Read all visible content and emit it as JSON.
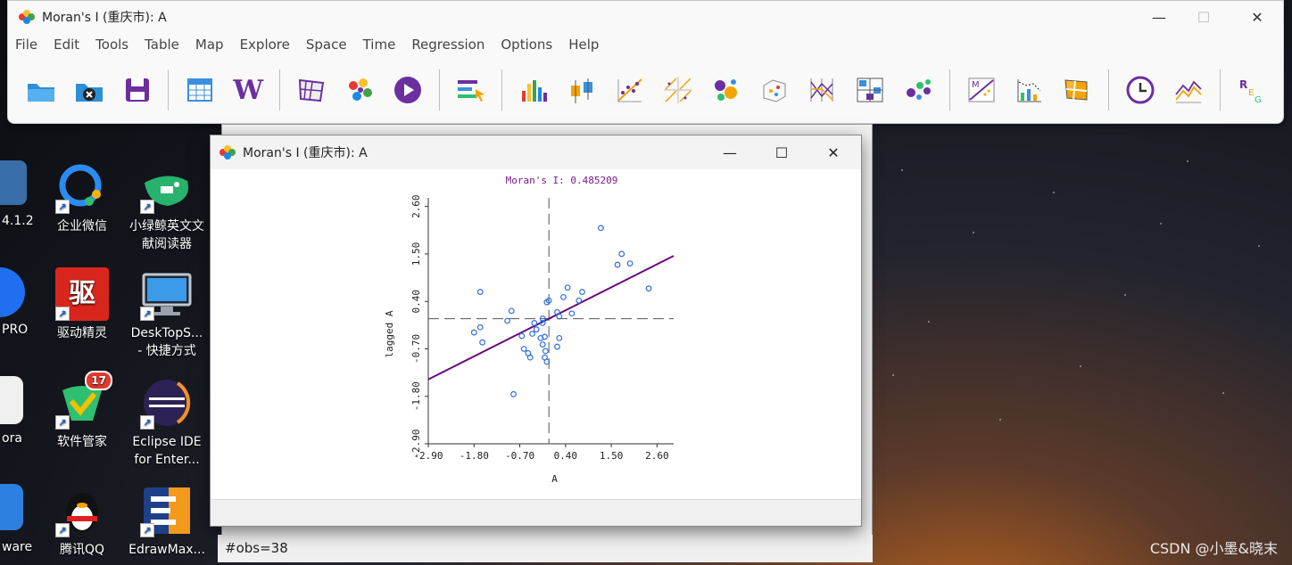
{
  "desktop": {
    "left_partial": [
      {
        "label": "4.1.2"
      },
      {
        "label": "PRO"
      },
      {
        "label": "ora"
      },
      {
        "label": "ware"
      }
    ],
    "col1": [
      {
        "label": "企业微信"
      },
      {
        "label": "驱动精灵"
      },
      {
        "label": "软件管家",
        "badge": "17"
      },
      {
        "label": "腾讯QQ"
      }
    ],
    "col2": [
      {
        "label": "小绿鲸英文文献阅读器"
      },
      {
        "label": "DeskTopS... - 快捷方式"
      },
      {
        "label": "Eclipse IDE for Enter..."
      },
      {
        "label": "EdrawMax..."
      }
    ]
  },
  "main_window": {
    "title": "Moran's I (重庆市): A",
    "menu": [
      "File",
      "Edit",
      "Tools",
      "Table",
      "Map",
      "Explore",
      "Space",
      "Time",
      "Regression",
      "Options",
      "Help"
    ],
    "tool_icons": [
      "open-project-icon",
      "close-project-icon",
      "save-icon",
      "table-icon",
      "weights-icon",
      "map-icon",
      "cluster-map-icon",
      "play-icon",
      "select-tool-icon",
      "histogram-icon",
      "box-plot-icon",
      "scatter-plot-icon",
      "scatter-matrix-icon",
      "bubble-chart-icon",
      "3d-plot-icon",
      "parallel-coordinate-icon",
      "conditional-map-icon",
      "cartogram-icon",
      "moran-scatter-icon",
      "lisa-icon",
      "local-g-icon",
      "time-icon",
      "averages-chart-icon",
      "regression-icon"
    ]
  },
  "moran_window": {
    "title": "Moran's I (重庆市): A",
    "status": "#obs=38"
  },
  "chart_data": {
    "type": "scatter",
    "title": "Moran's I: 0.485209",
    "xlabel": "A",
    "ylabel": "lagged A",
    "xlim": [
      -2.9,
      3.0
    ],
    "ylim": [
      -2.9,
      2.8
    ],
    "xticks": [
      "-2.90",
      "-1.80",
      "-0.70",
      "0.40",
      "1.50",
      "2.60"
    ],
    "yticks": [
      "-2.90",
      "-1.80",
      "-0.70",
      "0.40",
      "1.50",
      "2.60"
    ],
    "slope": 0.485209,
    "line_color": "#6a0a7a",
    "point_color": "#2f6fe0",
    "points": [
      [
        1.25,
        2.1
      ],
      [
        1.75,
        1.5
      ],
      [
        1.65,
        1.25
      ],
      [
        1.95,
        1.28
      ],
      [
        2.4,
        0.7
      ],
      [
        -1.65,
        0.62
      ],
      [
        -0.9,
        0.18
      ],
      [
        -1.0,
        -0.05
      ],
      [
        -1.65,
        -0.2
      ],
      [
        -1.8,
        -0.32
      ],
      [
        -1.6,
        -0.55
      ],
      [
        -0.65,
        -0.4
      ],
      [
        -0.6,
        -0.7
      ],
      [
        -0.5,
        -0.8
      ],
      [
        -0.45,
        -0.9
      ],
      [
        -0.85,
        -1.75
      ],
      [
        -0.3,
        -0.25
      ],
      [
        -0.15,
        -0.1
      ],
      [
        -0.2,
        -0.45
      ],
      [
        -0.15,
        -0.6
      ],
      [
        -0.1,
        -0.9
      ],
      [
        -0.05,
        -1.0
      ],
      [
        -0.1,
        -0.42
      ],
      [
        -0.08,
        -0.75
      ],
      [
        -0.05,
        0.38
      ],
      [
        0.0,
        0.42
      ],
      [
        0.2,
        0.15
      ],
      [
        0.25,
        0.05
      ],
      [
        0.35,
        0.5
      ],
      [
        0.45,
        0.72
      ],
      [
        0.55,
        0.12
      ],
      [
        0.72,
        0.42
      ],
      [
        0.8,
        0.62
      ],
      [
        -0.15,
        0.0
      ],
      [
        0.25,
        -0.45
      ],
      [
        0.2,
        -0.65
      ],
      [
        -0.4,
        -0.35
      ],
      [
        -0.35,
        -0.1
      ]
    ]
  }
}
